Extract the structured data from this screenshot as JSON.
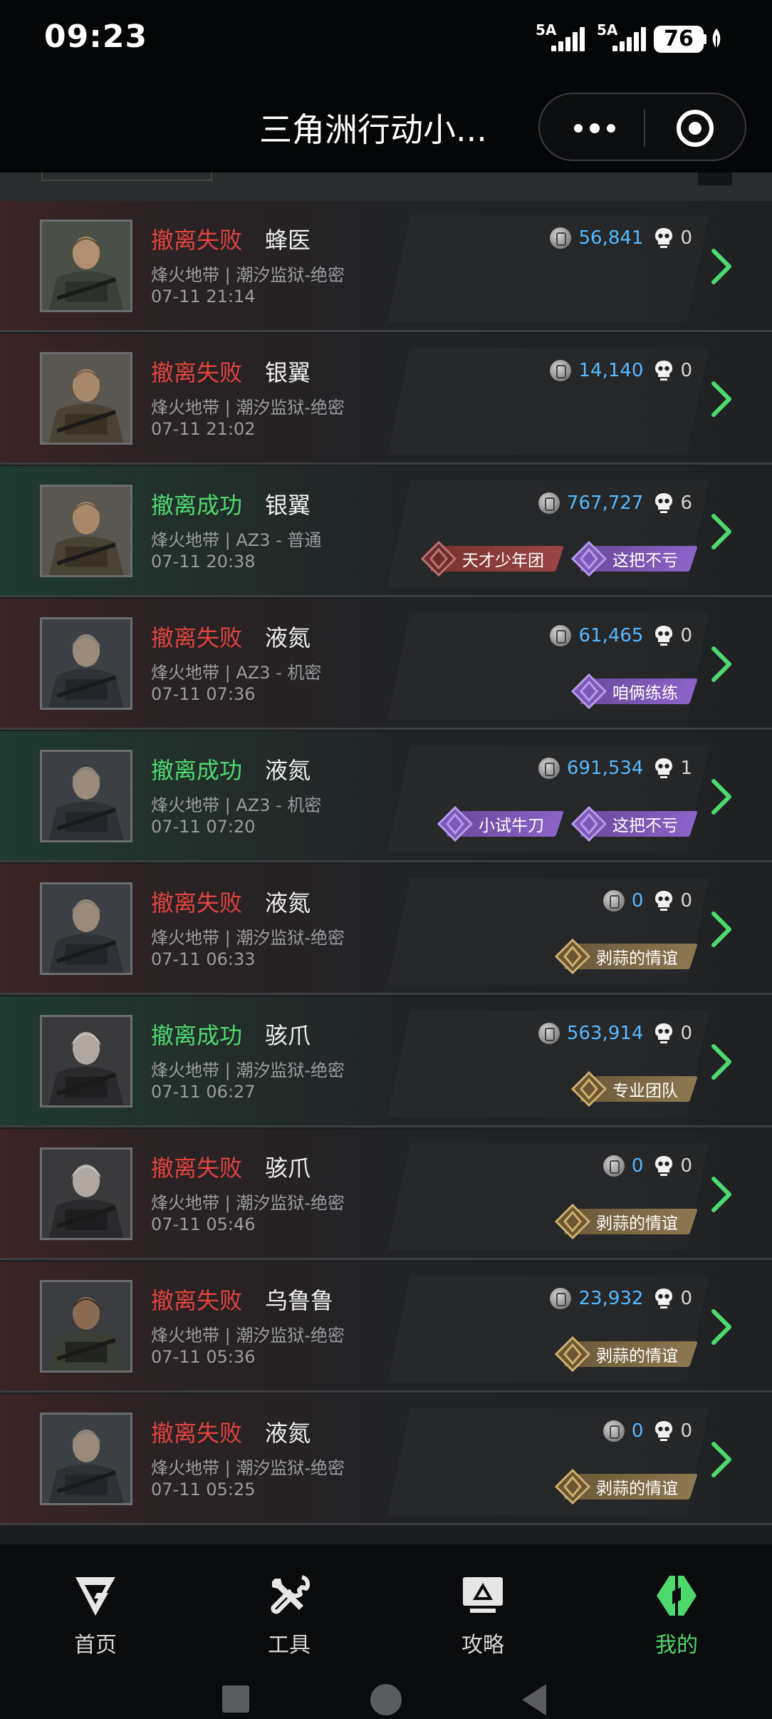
{
  "status_bar": {
    "time": "09:23",
    "signal1": "5A",
    "signal2": "5A",
    "battery": "76"
  },
  "nav": {
    "title": "三角洲行动小..."
  },
  "records": [
    {
      "status": "撤离失败",
      "result": "fail",
      "operator": "蜂医",
      "map": "烽火地带 | 潮汐监狱-绝密",
      "time": "07-11 21:14",
      "value": "56,841",
      "kills": "0",
      "avatar": "bee",
      "badges": []
    },
    {
      "status": "撤离失败",
      "result": "fail",
      "operator": "银翼",
      "map": "烽火地带 | 潮汐监狱-绝密",
      "time": "07-11 21:02",
      "value": "14,140",
      "kills": "0",
      "avatar": "wing",
      "badges": []
    },
    {
      "status": "撤离成功",
      "result": "success",
      "operator": "银翼",
      "map": "烽火地带 | AZ3 - 普通",
      "time": "07-11 20:38",
      "value": "767,727",
      "kills": "6",
      "avatar": "wing",
      "badges": [
        {
          "label": "天才少年团",
          "style": "red"
        },
        {
          "label": "这把不亏",
          "style": "purple"
        }
      ]
    },
    {
      "status": "撤离失败",
      "result": "fail",
      "operator": "液氮",
      "map": "烽火地带 | AZ3 - 机密",
      "time": "07-11 07:36",
      "value": "61,465",
      "kills": "0",
      "avatar": "frost",
      "badges": [
        {
          "label": "咱俩练练",
          "style": "purple"
        }
      ]
    },
    {
      "status": "撤离成功",
      "result": "success",
      "operator": "液氮",
      "map": "烽火地带 | AZ3 - 机密",
      "time": "07-11 07:20",
      "value": "691,534",
      "kills": "1",
      "avatar": "frost",
      "badges": [
        {
          "label": "小试牛刀",
          "style": "purple"
        },
        {
          "label": "这把不亏",
          "style": "purple"
        }
      ]
    },
    {
      "status": "撤离失败",
      "result": "fail",
      "operator": "液氮",
      "map": "烽火地带 | 潮汐监狱-绝密",
      "time": "07-11 06:33",
      "value": "0",
      "kills": "0",
      "avatar": "frost",
      "badges": [
        {
          "label": "剥蒜的情谊",
          "style": "gold"
        }
      ]
    },
    {
      "status": "撤离成功",
      "result": "success",
      "operator": "骇爪",
      "map": "烽火地带 | 潮汐监狱-绝密",
      "time": "07-11 06:27",
      "value": "563,914",
      "kills": "0",
      "avatar": "claw",
      "badges": [
        {
          "label": "专业团队",
          "style": "gold"
        }
      ]
    },
    {
      "status": "撤离失败",
      "result": "fail",
      "operator": "骇爪",
      "map": "烽火地带 | 潮汐监狱-绝密",
      "time": "07-11 05:46",
      "value": "0",
      "kills": "0",
      "avatar": "claw",
      "badges": [
        {
          "label": "剥蒜的情谊",
          "style": "gold"
        }
      ]
    },
    {
      "status": "撤离失败",
      "result": "fail",
      "operator": "乌鲁鲁",
      "map": "烽火地带 | 潮汐监狱-绝密",
      "time": "07-11 05:36",
      "value": "23,932",
      "kills": "0",
      "avatar": "uluru",
      "badges": [
        {
          "label": "剥蒜的情谊",
          "style": "gold"
        }
      ]
    },
    {
      "status": "撤离失败",
      "result": "fail",
      "operator": "液氮",
      "map": "烽火地带 | 潮汐监狱-绝密",
      "time": "07-11 05:25",
      "value": "0",
      "kills": "0",
      "avatar": "frost",
      "badges": [
        {
          "label": "剥蒜的情谊",
          "style": "gold"
        }
      ]
    }
  ],
  "tabs": [
    {
      "label": "首页",
      "icon": "home-logo-icon",
      "active": false
    },
    {
      "label": "工具",
      "icon": "tools-icon",
      "active": false
    },
    {
      "label": "攻略",
      "icon": "guide-monitor-icon",
      "active": false
    },
    {
      "label": "我的",
      "icon": "profile-logo-icon",
      "active": true
    }
  ],
  "colors": {
    "fail": "#e0433e",
    "success": "#4ed96f",
    "value": "#58b9ff",
    "accent": "#4ed96f"
  }
}
